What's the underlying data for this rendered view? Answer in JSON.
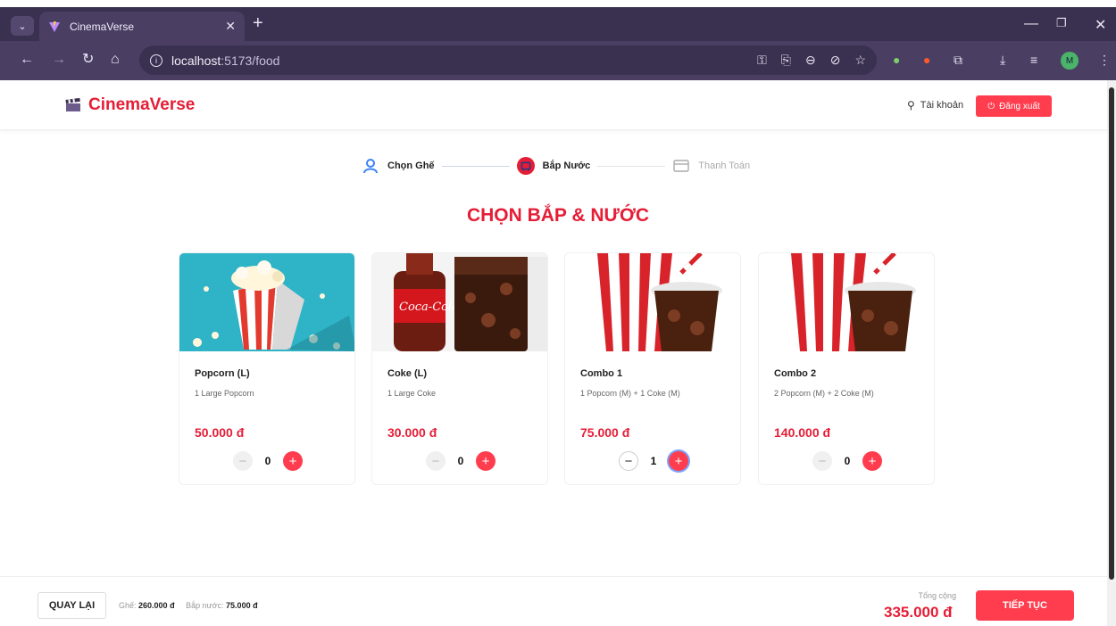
{
  "browser": {
    "tab_title": "CinemaVerse",
    "url_host": "localhost",
    "url_path": ":5173/food",
    "profile_initial": "M"
  },
  "header": {
    "brand": "CinemaVerse",
    "account_label": "Tài khoản",
    "logout_label": "Đăng xuất"
  },
  "steps": [
    {
      "label": "Chọn Ghế",
      "state": "done"
    },
    {
      "label": "Bắp Nước",
      "state": "active"
    },
    {
      "label": "Thanh Toán",
      "state": "pending"
    }
  ],
  "page_title": "CHỌN BẮP & NƯỚC",
  "items": [
    {
      "name": "Popcorn (L)",
      "desc": "1 Large Popcorn",
      "price": "50.000 đ",
      "qty": "0"
    },
    {
      "name": "Coke (L)",
      "desc": "1 Large Coke",
      "price": "30.000 đ",
      "qty": "0"
    },
    {
      "name": "Combo 1",
      "desc": "1 Popcorn (M) + 1 Coke (M)",
      "price": "75.000 đ",
      "qty": "1"
    },
    {
      "name": "Combo 2",
      "desc": "2 Popcorn (M) + 2 Coke (M)",
      "price": "140.000 đ",
      "qty": "0"
    }
  ],
  "footer": {
    "back_label": "QUAY LẠI",
    "seat_label": "Ghế:",
    "seat_value": "260.000 đ",
    "food_label": "Bắp nước:",
    "food_value": "75.000 đ",
    "total_label": "Tổng cộng",
    "total_value": "335.000 đ",
    "next_label": "TIẾP TỤC"
  },
  "colors": {
    "brand": "#e51d36",
    "button": "#ff3d4e",
    "chrome": "#4a3f63"
  }
}
